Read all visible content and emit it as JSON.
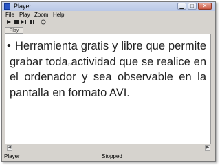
{
  "window": {
    "title": "Player"
  },
  "menu": [
    "File",
    "Play",
    "Zoom",
    "Help"
  ],
  "toolbar": {
    "buttons": [
      "play-icon",
      "stop-icon",
      "step-icon",
      "pause-icon",
      "info-icon"
    ],
    "status_label": "Play"
  },
  "content": {
    "text": "Herramienta gratis y libre que permite grabar toda actividad que se realice en el ordenador y sea observable en la pantalla en formato AVI."
  },
  "statusbar": {
    "app_name": "Player",
    "state": "Stopped"
  }
}
